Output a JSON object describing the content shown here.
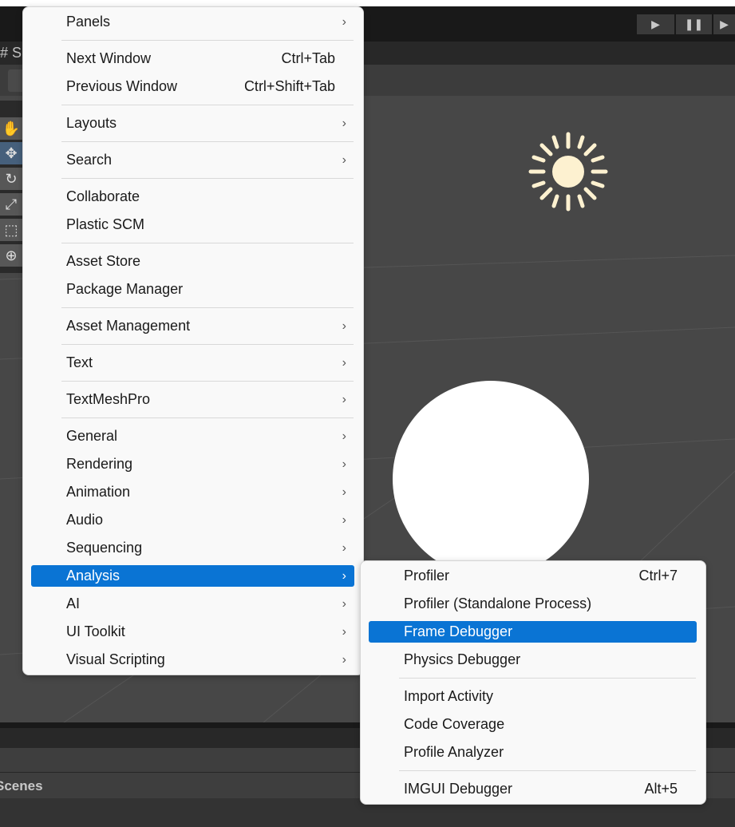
{
  "editor": {
    "scene_tab": "# S",
    "scenes_label": "Scenes",
    "play_icons": [
      "play-icon",
      "pause-icon",
      "step-icon"
    ]
  },
  "main_menu": {
    "items": [
      {
        "label": "Panels",
        "submenu": true
      },
      {
        "sep": true
      },
      {
        "label": "Next Window",
        "shortcut": "Ctrl+Tab"
      },
      {
        "label": "Previous Window",
        "shortcut": "Ctrl+Shift+Tab"
      },
      {
        "sep": true
      },
      {
        "label": "Layouts",
        "submenu": true
      },
      {
        "sep": true
      },
      {
        "label": "Search",
        "submenu": true
      },
      {
        "sep": true
      },
      {
        "label": "Collaborate"
      },
      {
        "label": "Plastic SCM"
      },
      {
        "sep": true
      },
      {
        "label": "Asset Store"
      },
      {
        "label": "Package Manager"
      },
      {
        "sep": true
      },
      {
        "label": "Asset Management",
        "submenu": true
      },
      {
        "sep": true
      },
      {
        "label": "Text",
        "submenu": true
      },
      {
        "sep": true
      },
      {
        "label": "TextMeshPro",
        "submenu": true
      },
      {
        "sep": true
      },
      {
        "label": "General",
        "submenu": true
      },
      {
        "label": "Rendering",
        "submenu": true
      },
      {
        "label": "Animation",
        "submenu": true
      },
      {
        "label": "Audio",
        "submenu": true
      },
      {
        "label": "Sequencing",
        "submenu": true
      },
      {
        "label": "Analysis",
        "submenu": true,
        "highlighted": true
      },
      {
        "label": "AI",
        "submenu": true
      },
      {
        "label": "UI Toolkit",
        "submenu": true
      },
      {
        "label": "Visual Scripting",
        "submenu": true
      }
    ]
  },
  "analysis_submenu": {
    "items": [
      {
        "label": "Profiler",
        "shortcut": "Ctrl+7"
      },
      {
        "label": "Profiler (Standalone Process)"
      },
      {
        "label": "Frame Debugger",
        "highlighted": true
      },
      {
        "label": "Physics Debugger"
      },
      {
        "sep": true
      },
      {
        "label": "Import Activity"
      },
      {
        "label": "Code Coverage"
      },
      {
        "label": "Profile Analyzer"
      },
      {
        "sep": true
      },
      {
        "label": "IMGUI Debugger",
        "shortcut": "Alt+5"
      }
    ]
  },
  "colors": {
    "highlight": "#0a74d4",
    "menu_bg": "#f9f9f9",
    "sun": "#fdf1d0"
  }
}
